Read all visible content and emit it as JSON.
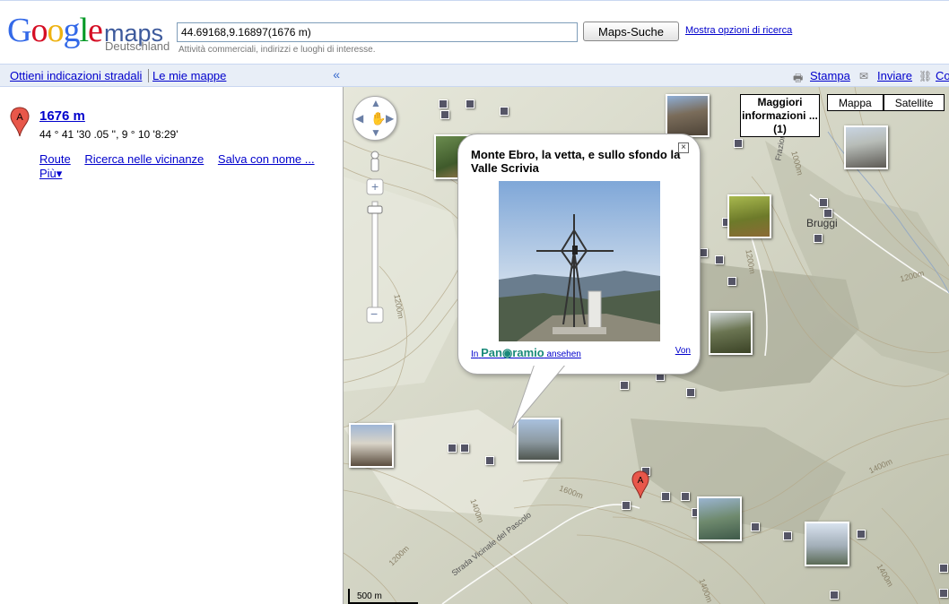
{
  "logo": {
    "g1": "G",
    "g2": "o",
    "g3": "o",
    "g4": "g",
    "g5": "l",
    "g6": "e",
    "maps": "maps",
    "region": "Deutschland"
  },
  "search": {
    "value": "44.69168,9.16897(1676 m)",
    "hint": "Attività commerciali, indirizzi e luoghi di interesse.",
    "button": "Maps-Suche",
    "options_link": "Mostra opzioni di ricerca"
  },
  "leftbar": {
    "directions": "Ottieni indicazioni stradali",
    "my_maps": "Le mie mappe",
    "collapse": "«"
  },
  "rightbar": {
    "print": "Stampa",
    "send": "Inviare",
    "link": "Co"
  },
  "result": {
    "marker": "A",
    "title": "1676 m",
    "coords": "44 ° 41 '30 .05 '', 9 ° 10 '8:29'",
    "links": [
      "Route",
      "Ricerca nelle vicinanze",
      "Salva con nome ..."
    ],
    "more": "Più▾"
  },
  "map": {
    "more_info": "Maggiori informazioni ... (1)",
    "types": [
      "Mappa",
      "Satellite"
    ],
    "place_label": "Bruggi",
    "road_label": "Strada Vicinale del Pascolo",
    "road_label2": "Frazione Bruggi",
    "contours": [
      "1200m",
      "1200m",
      "1000m",
      "1200m",
      "1400m",
      "1600m",
      "1400m",
      "1200m",
      "1400m",
      "1400m"
    ],
    "zoom_plus": "+",
    "zoom_minus": "−",
    "scale": "500 m",
    "marker": "A"
  },
  "bubble": {
    "title": "Monte Ebro, la vetta, e sullo sfondo la Valle Scrivia",
    "foot_pre": "In",
    "brand": "Pan◉ramio",
    "foot_post": "ansehen",
    "author": "Von",
    "close": "×"
  },
  "colors": {
    "link": "#0000cc",
    "bar": "#e8eef7",
    "marker": "#e8574a"
  }
}
